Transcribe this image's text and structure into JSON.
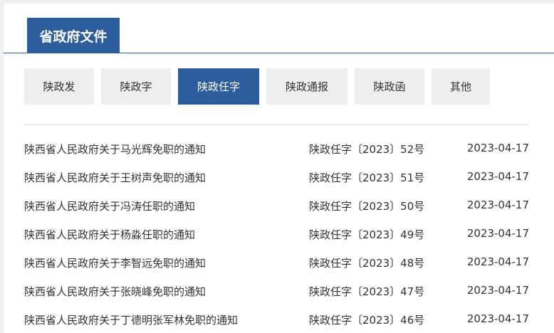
{
  "header": {
    "title": "省政府文件"
  },
  "tabs": [
    {
      "label": "陕政发",
      "active": false
    },
    {
      "label": "陕政字",
      "active": false
    },
    {
      "label": "陕政任字",
      "active": true
    },
    {
      "label": "陕政通报",
      "active": false
    },
    {
      "label": "陕政函",
      "active": false
    },
    {
      "label": "其他",
      "active": false
    }
  ],
  "documents": [
    {
      "title": "陕西省人民政府关于马光辉免职的通知",
      "number": "陕政任字〔2023〕52号",
      "date": "2023-04-17"
    },
    {
      "title": "陕西省人民政府关于王树声免职的通知",
      "number": "陕政任字〔2023〕51号",
      "date": "2023-04-17"
    },
    {
      "title": "陕西省人民政府关于冯涛任职的通知",
      "number": "陕政任字〔2023〕50号",
      "date": "2023-04-17"
    },
    {
      "title": "陕西省人民政府关于杨淼任职的通知",
      "number": "陕政任字〔2023〕49号",
      "date": "2023-04-17"
    },
    {
      "title": "陕西省人民政府关于李智远免职的通知",
      "number": "陕政任字〔2023〕48号",
      "date": "2023-04-17"
    },
    {
      "title": "陕西省人民政府关于张晓峰免职的通知",
      "number": "陕政任字〔2023〕47号",
      "date": "2023-04-17"
    },
    {
      "title": "陕西省人民政府关于丁德明张军林免职的通知",
      "number": "陕政任字〔2023〕46号",
      "date": "2023-04-17"
    }
  ],
  "colors": {
    "accent": "#2d5d9c",
    "tab_bg": "#eeeeee"
  }
}
